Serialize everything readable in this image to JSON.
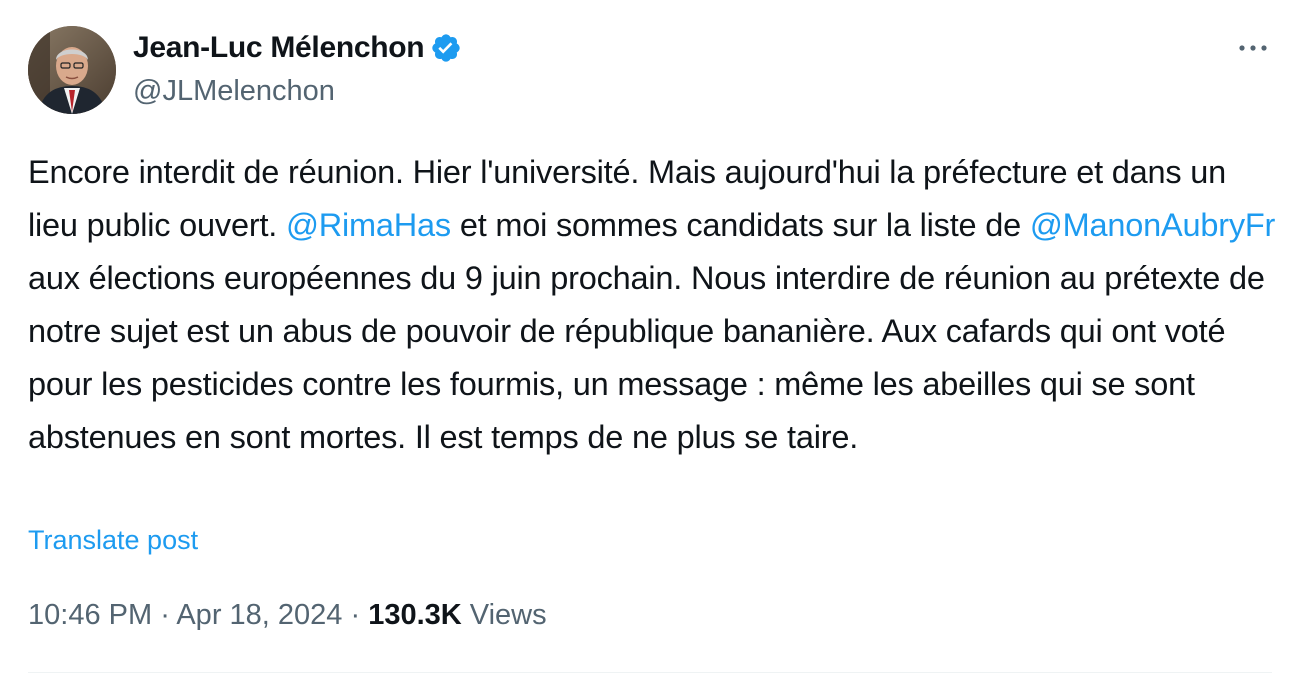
{
  "author": {
    "display_name": "Jean-Luc Mélenchon",
    "handle": "@JLMelenchon",
    "verified": true
  },
  "tweet": {
    "segments": [
      {
        "type": "text",
        "value": "Encore interdit de réunion. Hier l'université. Mais aujourd'hui la préfecture et dans un lieu public ouvert. "
      },
      {
        "type": "mention",
        "value": "@RimaHas"
      },
      {
        "type": "text",
        "value": " et moi sommes candidats sur la liste de "
      },
      {
        "type": "mention",
        "value": "@ManonAubryFr"
      },
      {
        "type": "text",
        "value": " aux élections européennes du 9 juin prochain. Nous interdire de réunion au prétexte de notre sujet est un abus de pouvoir de république bananière. Aux cafards qui ont voté pour les pesticides contre les fourmis, un message : même les abeilles qui se sont abstenues en sont mortes. Il est temps de ne plus se taire."
      }
    ],
    "translate_label": "Translate post",
    "time": "10:46 PM",
    "date": "Apr 18, 2024",
    "separator": "·",
    "views_count": "130.3K",
    "views_label": "Views"
  },
  "colors": {
    "link": "#1d9bf0",
    "text": "#0f1419",
    "secondary": "#536471",
    "verified_badge": "#1d9bf0"
  },
  "icons": {
    "verified": "verified-badge-icon",
    "more": "more-options-icon"
  }
}
